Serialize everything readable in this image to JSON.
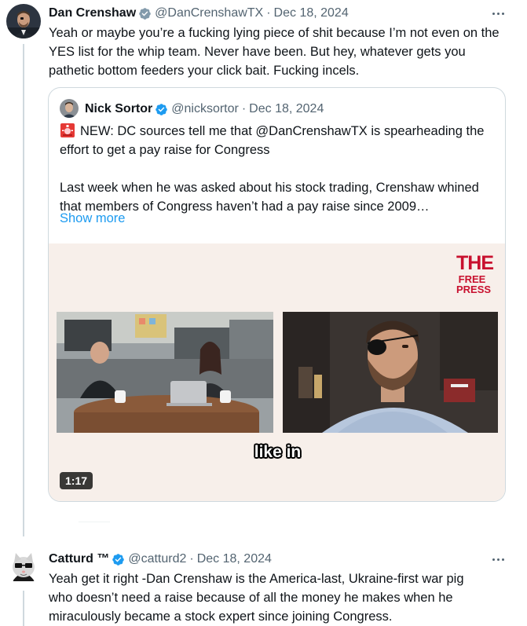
{
  "tweets": [
    {
      "name": "Dan Crenshaw",
      "verified": "gray",
      "handle": "@DanCrenshawTX",
      "separator": "·",
      "date": "Dec 18, 2024",
      "text": "Yeah or maybe you’re a fucking lying piece of shit because I’m not even on the YES list for the whip team. Never have been. But hey, whatever gets you pathetic bottom feeders your click bait. Fucking incels.",
      "quote": {
        "name": "Nick Sortor",
        "verified": "blue",
        "handle": "@nicksortor",
        "separator": "·",
        "date": "Dec 18, 2024",
        "text_line1": "NEW: DC sources tell me that @DanCrenshawTX is spearheading the effort to get a pay raise for Congress",
        "text_line2": "Last week when he was asked about his stock trading, Crenshaw whined that members of Congress haven’t had a pay raise since 2009…",
        "show_more": "Show more",
        "media": {
          "logo_line1": "THE",
          "logo_line2": "FREE",
          "logo_line3": "PRESS",
          "caption": "like in",
          "duration": "1:17"
        }
      }
    },
    {
      "name": "Catturd ™",
      "verified": "blue",
      "handle": "@catturd2",
      "separator": "·",
      "date": "Dec 18, 2024",
      "text": "Yeah get it right -Dan Crenshaw is the America-last, Ukraine-first war pig who doesn’t need a raise because of all the money he makes when he miraculously became a stock expert since joining Congress."
    }
  ],
  "colors": {
    "text": "#0f1419",
    "secondary": "#536471",
    "link": "#1d9bf0",
    "verified_gray": "#829aab",
    "verified_blue": "#1d9bf0",
    "brand_red": "#c8102e"
  }
}
